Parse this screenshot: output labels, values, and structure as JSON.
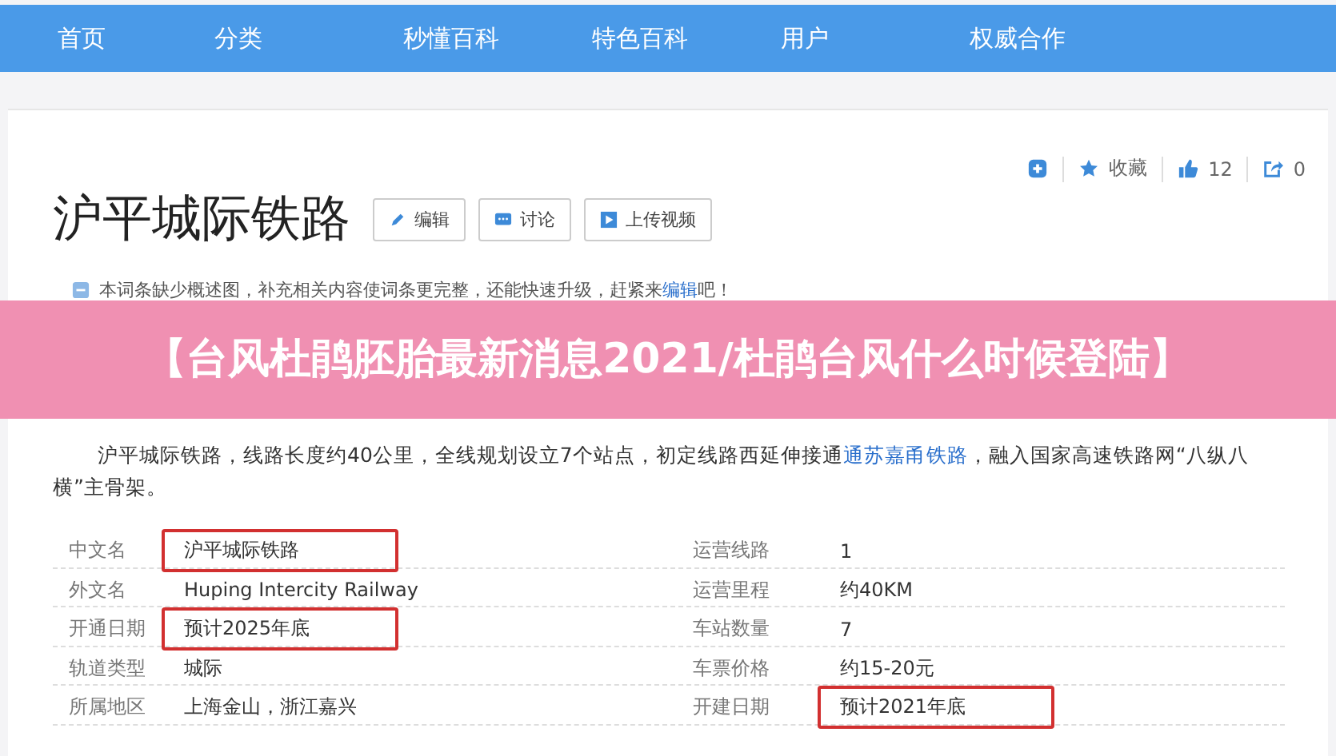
{
  "nav": {
    "items": [
      {
        "label": "首页"
      },
      {
        "label": "分类"
      },
      {
        "label": "秒懂百科"
      },
      {
        "label": "特色百科"
      },
      {
        "label": "用户"
      },
      {
        "label": "权威合作"
      }
    ]
  },
  "actions": {
    "favorite": "收藏",
    "likes": "12",
    "shares": "0"
  },
  "title": "沪平城际铁路",
  "title_buttons": [
    {
      "kind": "edit",
      "label": "编辑"
    },
    {
      "kind": "discuss",
      "label": "讨论"
    },
    {
      "kind": "video",
      "label": "上传视频"
    }
  ],
  "notice": {
    "text": "本词条缺少概述图，补充相关内容使词条更完整，还能快速升级，赶紧来",
    "link": "编辑",
    "tail": "吧！"
  },
  "banner": {
    "text": "【台风杜鹃胚胎最新消息2021/杜鹃台风什么时候登陆】"
  },
  "paragraph": {
    "before": "沪平城际铁路，线路长度约40公里，全线规划设立7个站点，初定线路西延伸接通",
    "link": "通苏嘉甬铁路",
    "after": "，融入国家高速铁路网“八纵八横”主骨架。"
  },
  "infobox": {
    "rows": [
      {
        "left": {
          "label": "中文名",
          "value": "沪平城际铁路",
          "highlighted": true
        },
        "right": {
          "label": "运营线路",
          "value": "1",
          "highlighted": false
        }
      },
      {
        "left": {
          "label": "外文名",
          "value": "Huping Intercity Railway",
          "highlighted": false
        },
        "right": {
          "label": "运营里程",
          "value": "约40KM",
          "highlighted": false
        }
      },
      {
        "left": {
          "label": "开通日期",
          "value": "预计2025年底",
          "highlighted": true
        },
        "right": {
          "label": "车站数量",
          "value": "7",
          "highlighted": false
        }
      },
      {
        "left": {
          "label": "轨道类型",
          "value": "城际",
          "highlighted": false
        },
        "right": {
          "label": "车票价格",
          "value": "约15-20元",
          "highlighted": false
        }
      },
      {
        "left": {
          "label": "所属地区",
          "value": "上海金山，浙江嘉兴",
          "highlighted": false
        },
        "right": {
          "label": "开建日期",
          "value": "预计2021年底",
          "highlighted": true
        }
      }
    ]
  }
}
